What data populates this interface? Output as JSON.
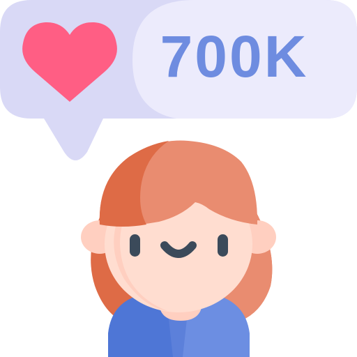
{
  "like_bubble": {
    "count": "700K",
    "icon": "heart-icon"
  },
  "avatar": {
    "icon": "girl-avatar-icon"
  },
  "colors": {
    "bubble_dark": "#D9D9F6",
    "bubble_light": "#ECEBFC",
    "heart": "#FF5E84",
    "count_text": "#6E8CE0",
    "hair_dark": "#DE6B46",
    "hair_light": "#E98C70",
    "skin": "#FFDDD0",
    "skin_shadow": "#FFCFC0",
    "face_features": "#3B4A5A",
    "shirt_dark": "#4E76D6",
    "shirt_light": "#6C8EE2"
  }
}
